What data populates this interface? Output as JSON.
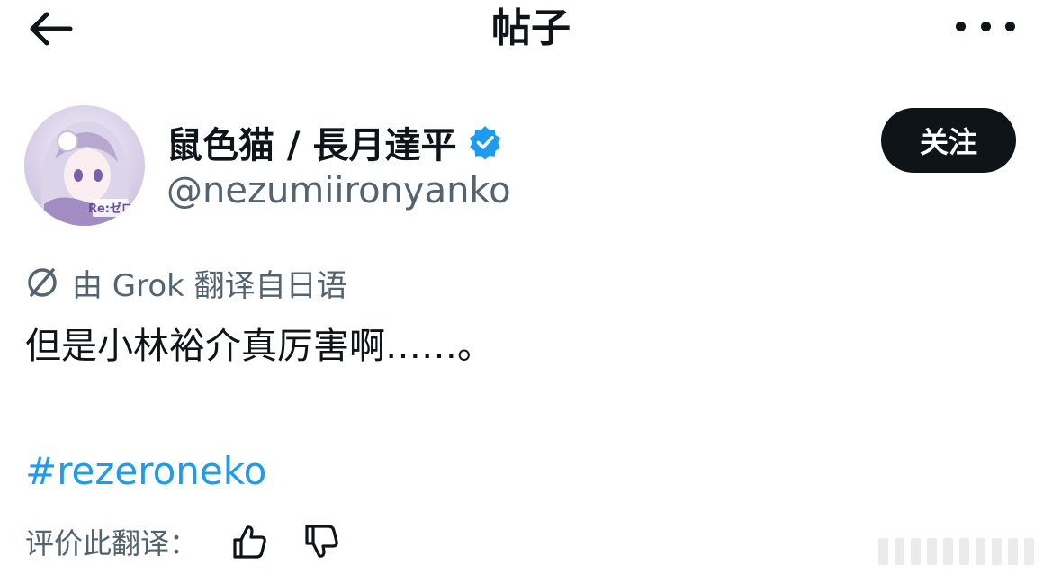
{
  "header": {
    "title": "帖子",
    "back_icon": "arrow-left-icon",
    "more_icon": "more-horizontal-icon"
  },
  "author": {
    "display_name": "鼠色猫 / 長月達平",
    "handle": "@nezumiironyanko",
    "verified_icon": "verified-badge-icon",
    "verified_color": "#1d9bf0",
    "avatar_text": "Re:ゼロ"
  },
  "follow_button": {
    "label": "关注"
  },
  "translation": {
    "icon": "translate-slash-icon",
    "note": "由 Grok 翻译自日语"
  },
  "post": {
    "text": "但是小林裕介真厉害啊……。",
    "hashtag": "#rezeroneko",
    "hashtag_color": "#1d9bf0"
  },
  "rating": {
    "label": "评价此翻译：",
    "like_icon": "thumbs-up-icon",
    "dislike_icon": "thumbs-down-icon"
  }
}
